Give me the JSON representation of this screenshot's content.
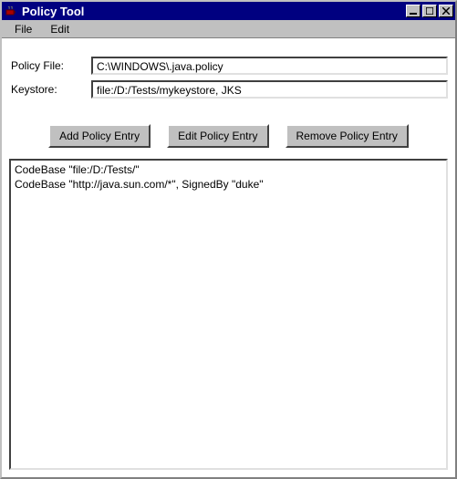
{
  "window": {
    "title": "Policy Tool"
  },
  "menubar": {
    "file": "File",
    "edit": "Edit"
  },
  "form": {
    "policy_file_label": "Policy File:",
    "policy_file_value": "C:\\WINDOWS\\.java.policy",
    "keystore_label": "Keystore:",
    "keystore_value": "file:/D:/Tests/mykeystore, JKS"
  },
  "buttons": {
    "add": "Add Policy Entry",
    "edit": "Edit Policy Entry",
    "remove": "Remove Policy Entry"
  },
  "entries": [
    "CodeBase \"file:/D:/Tests/\"",
    "CodeBase \"http://java.sun.com/*\", SignedBy \"duke\""
  ]
}
